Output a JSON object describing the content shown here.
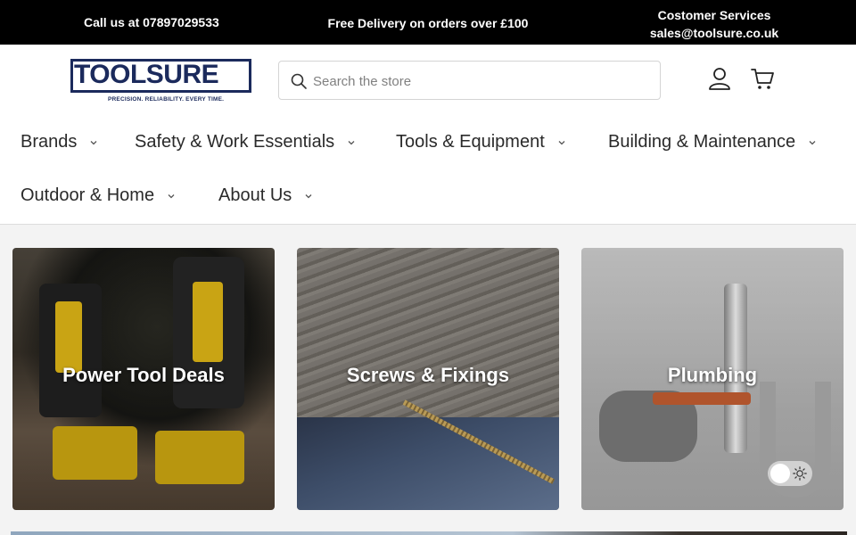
{
  "topbar": {
    "call": "Call us at 07897029533",
    "delivery": "Free Delivery on orders over £100",
    "cs_title": "Costomer Services",
    "cs_email": "sales@toolsure.co.uk"
  },
  "logo": {
    "name": "TOOLSURE",
    "tagline": "PRECISION. RELIABILITY. EVERY TIME."
  },
  "search": {
    "placeholder": "Search the store",
    "value": ""
  },
  "icons": {
    "search": "search-icon",
    "account": "account-icon",
    "cart": "cart-icon",
    "chevron": "chevron-down-icon",
    "theme": "sun-icon"
  },
  "nav": {
    "items": [
      {
        "label": "Brands"
      },
      {
        "label": "Safety & Work Essentials"
      },
      {
        "label": "Tools & Equipment"
      },
      {
        "label": "Building & Maintenance"
      },
      {
        "label": "Outdoor & Home"
      },
      {
        "label": "About Us"
      }
    ]
  },
  "categories": [
    {
      "label": "Power Tool Deals"
    },
    {
      "label": "Screws & Fixings"
    },
    {
      "label": "Plumbing"
    }
  ],
  "colors": {
    "topbar_bg": "#000000",
    "brand_navy": "#1b2a5c",
    "page_bg": "#f3f3f3"
  }
}
